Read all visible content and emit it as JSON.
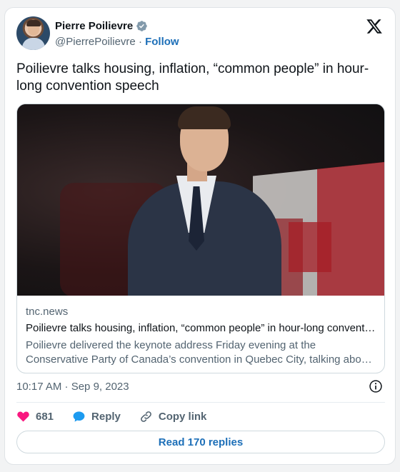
{
  "author": {
    "name": "Pierre Poilievre",
    "handle": "@PierrePoilievre",
    "separator": "·",
    "follow_label": "Follow"
  },
  "tweet": {
    "text": "Poilievre talks housing, inflation, “common people” in hour-long convention speech",
    "timestamp": "10:17 AM · Sep 9, 2023"
  },
  "link_card": {
    "domain": "tnc.news",
    "title": "Poilievre talks housing, inflation, “common people” in hour-long convent…",
    "description": "Poilievre delivered the keynote address Friday evening at the Conservative Party of Canada’s convention in Quebec City, talking abo…"
  },
  "actions": {
    "like_count": "681",
    "reply_label": "Reply",
    "copy_link_label": "Copy link"
  },
  "read_replies_label": "Read 170 replies",
  "icons": [
    "verified-badge-icon",
    "x-logo-icon",
    "info-icon",
    "heart-icon",
    "reply-bubble-icon",
    "link-icon"
  ],
  "colors": {
    "accent": "#1d6fb8",
    "like": "#f91880",
    "reply": "#1d9bf0",
    "verified": "#829aab",
    "muted_text": "#536471"
  }
}
